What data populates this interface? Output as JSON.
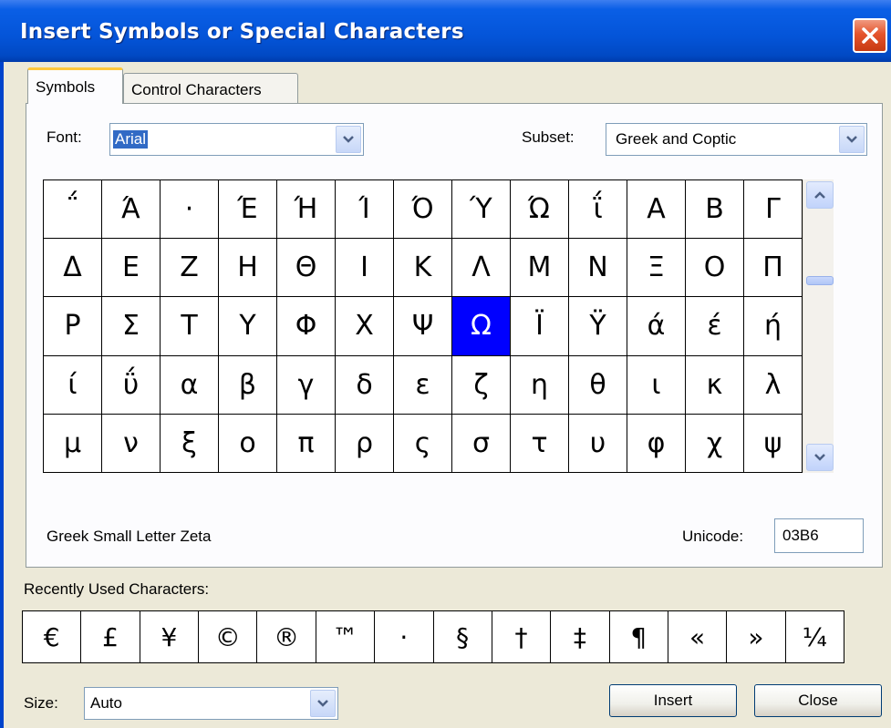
{
  "window": {
    "title": "Insert Symbols or Special Characters"
  },
  "tabs": [
    {
      "label": "Symbols",
      "active": true
    },
    {
      "label": "Control Characters",
      "active": false
    }
  ],
  "font": {
    "label": "Font:",
    "value": "Arial"
  },
  "subset": {
    "label": "Subset:",
    "value": "Greek and Coptic"
  },
  "grid": {
    "selected_char": "Ω",
    "rows": [
      [
        "΅",
        "Ά",
        "·",
        "Έ",
        "Ή",
        "Ί",
        "Ό",
        "Ύ",
        "Ώ",
        "ΐ",
        "Α",
        "Β",
        "Γ"
      ],
      [
        "Δ",
        "Ε",
        "Ζ",
        "Η",
        "Θ",
        "Ι",
        "Κ",
        "Λ",
        "Μ",
        "Ν",
        "Ξ",
        "Ο",
        "Π"
      ],
      [
        "Ρ",
        "Σ",
        "Τ",
        "Υ",
        "Φ",
        "Χ",
        "Ψ",
        "Ω",
        "Ϊ",
        "Ϋ",
        "ά",
        "έ",
        "ή"
      ],
      [
        "ί",
        "ΰ",
        "α",
        "β",
        "γ",
        "δ",
        "ε",
        "ζ",
        "η",
        "θ",
        "ι",
        "κ",
        "λ"
      ],
      [
        "μ",
        "ν",
        "ξ",
        "ο",
        "π",
        "ρ",
        "ς",
        "σ",
        "τ",
        "υ",
        "φ",
        "χ",
        "ψ"
      ]
    ]
  },
  "char_name": "Greek Small Letter Zeta",
  "unicode": {
    "label": "Unicode:",
    "value": "03B6"
  },
  "recent": {
    "label": "Recently Used Characters:",
    "chars": [
      "€",
      "£",
      "¥",
      "©",
      "®",
      "™",
      "·",
      "§",
      "†",
      "‡",
      "¶",
      "«",
      "»",
      "¼"
    ]
  },
  "size": {
    "label": "Size:",
    "value": "Auto"
  },
  "buttons": {
    "insert": "Insert",
    "close": "Close"
  },
  "colors": {
    "selection": "#0000ff",
    "titlebar": "#0454d8"
  },
  "icons": {
    "close": "close-icon",
    "dropdown": "chevron-down-icon",
    "scroll_up": "scroll-up-icon",
    "scroll_down": "scroll-down-icon"
  }
}
